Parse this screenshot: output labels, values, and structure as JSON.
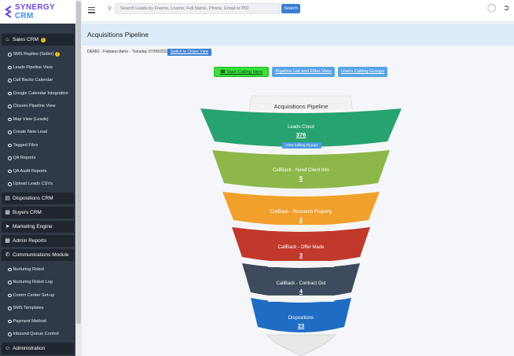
{
  "logo": {
    "text_a": "SYNERGY",
    "text_b": "CRM"
  },
  "search": {
    "placeholder": "Search Leads by Fname, Lname, Full Name, Phone, Email or PID",
    "button": "Search"
  },
  "sidebar": {
    "sales_crm": "Sales CRM",
    "sales_items": [
      "SMS Replies (Seller)",
      "Leads Pipeline View",
      "Call Backs Calendar",
      "Google Calendar Integration",
      "Closers Pipeline View",
      "Map View (Leads)",
      "Create New Lead",
      "Tagged Files",
      "QA Reports",
      "QA Audit Reports",
      "Upload Leads CSVs"
    ],
    "dispositions_crm": "Dispositions CRM",
    "buyers_crm": "Buyers CRM",
    "marketing_engine": "Marketing Engine",
    "admin_reports": "Admin Reports",
    "communications_module": "Communications Module",
    "comm_items": [
      "Nurturing Robot",
      "Nurturing Robot Log",
      "Comm Center Set-up",
      "SMS Templates",
      "Payment Method",
      "Inbound Queue Control"
    ],
    "administration": "Administration"
  },
  "page": {
    "title": "Acquisitions Pipeline",
    "breadcrumb": "DEMO - Fabiano Astro - Tuesday 07/05/2022",
    "switch_button": "Switch to Closer View",
    "start_calling": "Start Calling Here",
    "pipeline_list": "Pipeline List and Filter View",
    "users_calling_groups": "Users Calling Groups"
  },
  "funnel": {
    "title": "Acquisitions Pipeline",
    "view_calling_groups": "View Calling Groups",
    "stages": [
      {
        "label": "Leads Cloud",
        "count": "376",
        "color": "#27a36f"
      },
      {
        "label": "CallBack - Need Client Info",
        "count": "5",
        "color": "#8db74a"
      },
      {
        "label": "CallBack - Research Property",
        "count": "2",
        "color": "#f0a02b"
      },
      {
        "label": "CallBack - Offer Made",
        "count": "3",
        "color": "#c0392b"
      },
      {
        "label": "CallBack - Contract Out",
        "count": "4",
        "color": "#3d4b5c"
      },
      {
        "label": "Dispositions",
        "count": "23",
        "color": "#1f6cc4"
      }
    ]
  }
}
